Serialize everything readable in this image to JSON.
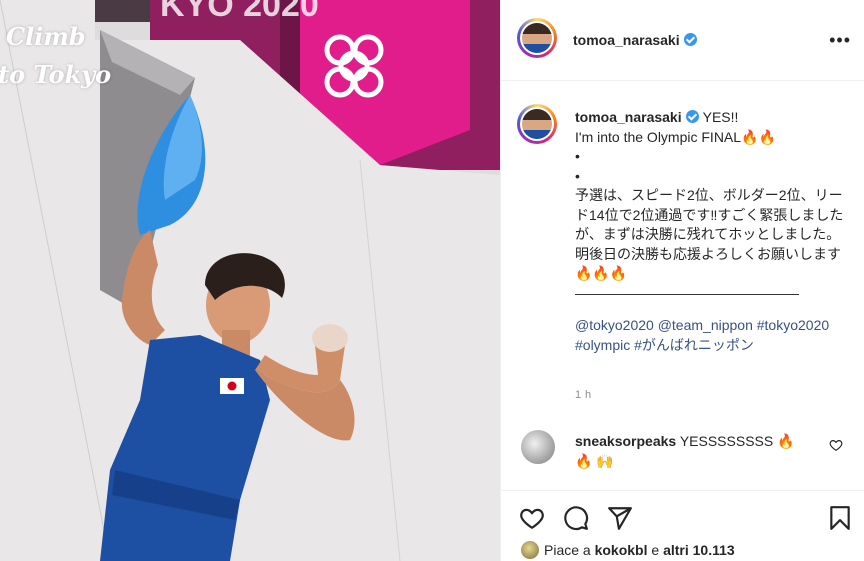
{
  "photo": {
    "overlay_line1": "Climb",
    "overlay_line2": "to Tokyo",
    "banner_year": "KYO 2020"
  },
  "post": {
    "username": "tomoa_narasaki",
    "verified": true,
    "more_icon": "more-horizontal-icon",
    "caption_lines": [
      "YES!!",
      "I'm into the Olympic FINAL🔥🔥",
      "•",
      "•",
      "予選は、スピード2位、ボルダー2位、リード14位で2位通過です‼︎すごく緊張しましたが、まずは決勝に残れてホッとしました。明後日の決勝も応援よろしくお願いします🔥🔥🔥",
      "————————————————"
    ],
    "tags": "@tokyo2020 @team_nippon #tokyo2020 #olympic #がんばれニッポン",
    "timestamp": "1 h"
  },
  "comment": {
    "username": "sneaksorpeaks",
    "text": "YESSSSSSSS 🔥🔥 🙌"
  },
  "actions": {
    "like_icon": "heart-icon",
    "comment_icon": "comment-icon",
    "share_icon": "share-icon",
    "save_icon": "bookmark-icon"
  },
  "likes": {
    "prefix": "Piace a",
    "user": "kokokbl",
    "middle": "e",
    "others": "altri 10.113"
  },
  "colors": {
    "link": "#385185",
    "verified": "#3897f0",
    "banner_magenta": "#b02a8a",
    "jersey_blue": "#1d4fa3",
    "hold_blue": "#2e8ee0"
  }
}
